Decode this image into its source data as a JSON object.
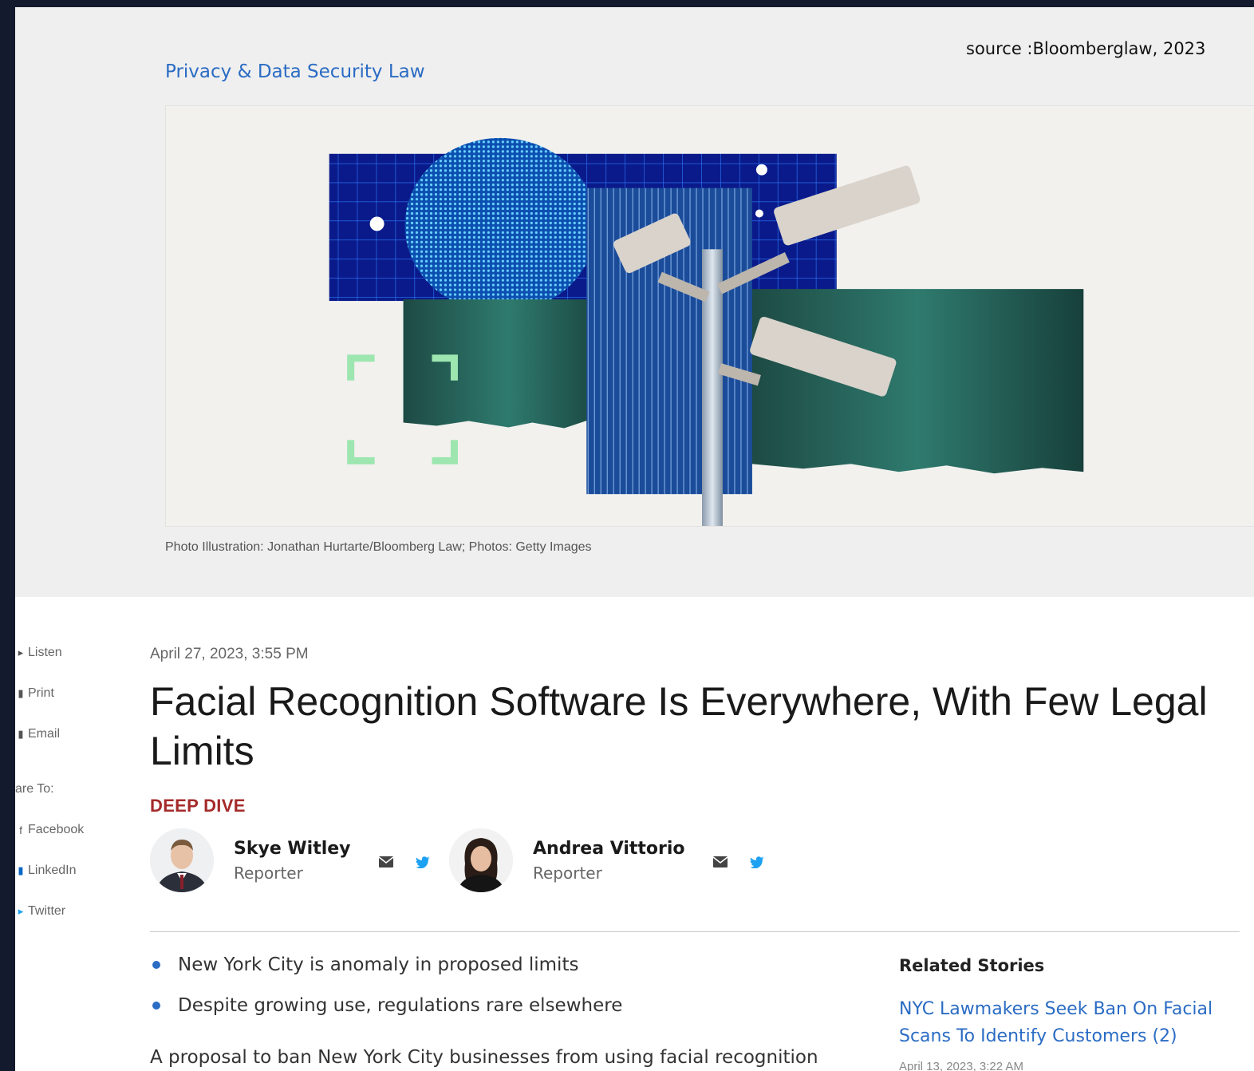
{
  "source_note": "source :Bloomberglaw, 2023",
  "section": {
    "label": "Privacy & Data Security Law"
  },
  "image_caption": "Photo Illustration: Jonathan Hurtarte/Bloomberg Law; Photos: Getty Images",
  "share_rail": {
    "listen": "Listen",
    "print": "Print",
    "email": "Email",
    "share_to": "are To:",
    "facebook": "Facebook",
    "linkedin": "LinkedIn",
    "twitter": "Twitter"
  },
  "article": {
    "date": "April 27, 2023, 3:55 PM",
    "headline": "Facial Recognition Software Is Everywhere, With Few Legal Limits",
    "kicker": "DEEP DIVE",
    "authors": [
      {
        "name": "Skye Witley",
        "role": "Reporter"
      },
      {
        "name": "Andrea Vittorio",
        "role": "Reporter"
      }
    ],
    "bullets": [
      "New York City is anomaly in proposed limits",
      "Despite growing use, regulations rare elsewhere"
    ],
    "lede": "A proposal to ban New York City businesses from using facial recognition"
  },
  "related": {
    "title": "Related Stories",
    "items": [
      {
        "title": "NYC Lawmakers Seek Ban On Facial Scans To Identify Customers (2)",
        "date": "April 13, 2023, 3:22 AM"
      }
    ]
  },
  "colors": {
    "link": "#2b6cc4",
    "kicker": "#a52a2a",
    "twitter": "#1da1f2",
    "hero_bg": "#efefef"
  }
}
